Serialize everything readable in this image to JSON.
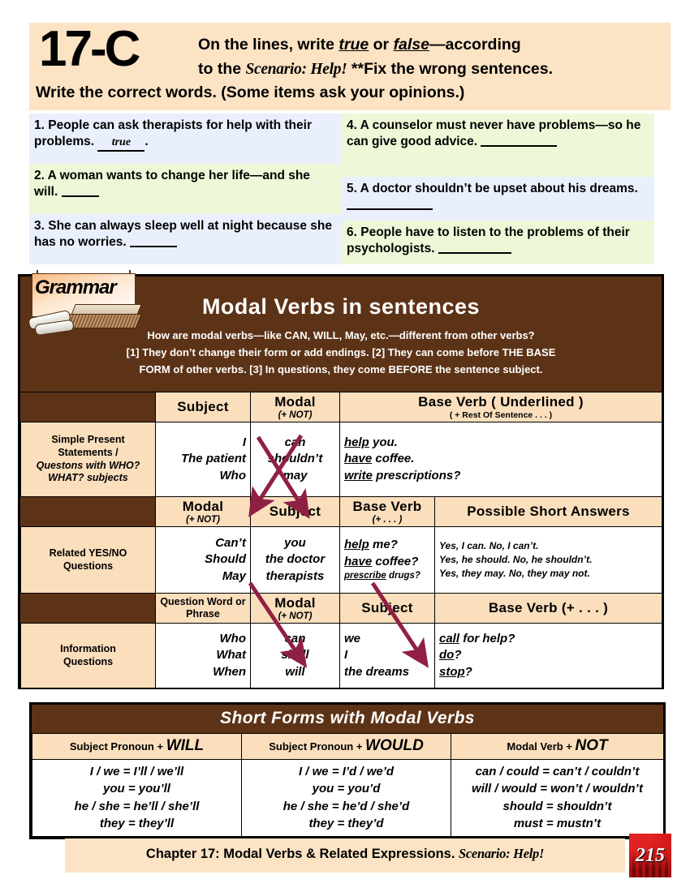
{
  "header": {
    "exercise_number": "17-C",
    "line1_pre": "On the lines, write ",
    "line1_true": "true",
    "line1_mid": " or ",
    "line1_false": "false",
    "line1_post": "—according",
    "line2_pre": "to the ",
    "line2_scenario": "Scenario: Help!",
    "line2_post": "  **Fix the wrong sentences.",
    "line3": "Write the correct words. (Some items ask your opinions.)"
  },
  "exercises": [
    {
      "num": "1.",
      "text": "People can ask therapists for help with their problems.",
      "answer": "true",
      "has_period": true,
      "blank_width": 0,
      "shade": "blue"
    },
    {
      "num": "2.",
      "text": "A woman wants to change her life—and she will.",
      "answer": "",
      "has_period": false,
      "blank_width": 46,
      "shade": "green"
    },
    {
      "num": "3.",
      "text": "She can always sleep well at night because she has no worries.",
      "answer": "",
      "has_period": false,
      "blank_width": 58,
      "shade": "blue"
    },
    {
      "num": "4.",
      "text": "A counselor must never have problems—so he can give good advice.",
      "answer": "",
      "has_period": false,
      "blank_width": 94,
      "shade": "green"
    },
    {
      "num": "5.",
      "text": "A doctor shouldn’t be upset about his dreams.",
      "answer": "",
      "has_period": false,
      "blank_width": 106,
      "shade": "blue"
    },
    {
      "num": "6.",
      "text": "People have to listen to the problems of their psychologists.",
      "answer": "",
      "has_period": false,
      "blank_width": 90,
      "shade": "green"
    }
  ],
  "grammar": {
    "logo_label": "Grammar",
    "title": "Modal Verbs in sentences",
    "intro_line1": "How are modal verbs—like CAN,  WILL, May, etc.—different from other verbs?",
    "intro_line2": "[1] They don’t change their form or add endings.  [2] They can come before THE BASE",
    "intro_line3": "FORM of other verbs.   [3]  In questions, they come BEFORE the sentence subject."
  },
  "table": {
    "header_row_1": {
      "subject": "Subject",
      "modal": "Modal",
      "modal_sub": "(+ NOT)",
      "base_verb": "Base Verb ( Underlined )",
      "base_verb_sub": "( + Rest Of Sentence . . . )"
    },
    "row_1": {
      "label_lines": [
        "Simple Present",
        "Statements /",
        "Questons with WHO?",
        "WHAT? subjects"
      ],
      "subjects": [
        "I",
        "The patient",
        "Who"
      ],
      "modals": [
        "can",
        "shouldn’t",
        "may"
      ],
      "base_verbs": [
        {
          "verb": "help",
          "rest": " you."
        },
        {
          "verb": "have",
          "rest": " coffee."
        },
        {
          "verb": "write",
          "rest": " prescriptions?"
        }
      ]
    },
    "header_row_2": {
      "modal": "Modal",
      "modal_sub": "(+ NOT)",
      "subject": "Subject",
      "base_verb": "Base Verb",
      "base_verb_sub": "(+ . . . )",
      "answers": "Possible Short Answers"
    },
    "row_2": {
      "label_lines": [
        "Related YES/NO",
        "Questions"
      ],
      "modals": [
        "Can’t",
        "Should",
        "May"
      ],
      "subjects": [
        "you",
        "the doctor",
        "therapists"
      ],
      "base_verbs": [
        {
          "verb": "help",
          "rest": " me?"
        },
        {
          "verb": "have",
          "rest": " coffee?"
        },
        {
          "verb": "prescribe",
          "rest": " drugs?"
        }
      ],
      "short_answers": [
        "Yes, I can. No, I can’t.",
        "Yes, he should. No, he shouldn’t.",
        "Yes, they may. No, they may not."
      ]
    },
    "header_row_3": {
      "qword": "Question Word or Phrase",
      "modal": "Modal",
      "modal_sub": "(+ NOT)",
      "subject": "Subject",
      "base_verb": "Base Verb  (+ . . . )"
    },
    "row_3": {
      "label_lines": [
        "Information",
        "Questions"
      ],
      "qwords": [
        "Who",
        "What",
        "When"
      ],
      "modals": [
        "can",
        "shall",
        "will"
      ],
      "subjects": [
        "we",
        "I",
        "the dreams"
      ],
      "base_verbs": [
        {
          "verb": "call",
          "rest": " for help?"
        },
        {
          "verb": "do",
          "rest": "?"
        },
        {
          "verb": "stop",
          "rest": "?"
        }
      ]
    }
  },
  "short_forms": {
    "title": "Short Forms with Modal Verbs",
    "columns": [
      {
        "head_small": "Subject Pronoun",
        "head_plus": " + ",
        "head_big": "WILL",
        "rows": [
          "I / we  = I’ll / we’ll",
          "you  = you’ll",
          "he / she  = he’ll / she’ll",
          "they  = they’ll"
        ]
      },
      {
        "head_small": "Subject Pronoun",
        "head_plus": " + ",
        "head_big": "WOULD",
        "rows": [
          "I / we  = I’d / we’d",
          "you  = you’d",
          "he / she  = he’d / she’d",
          "they  = they’d"
        ]
      },
      {
        "head_small": "Modal Verb",
        "head_plus": "  + ",
        "head_big": "NOT",
        "rows": [
          "can / could  = can’t / couldn’t",
          "will / would  = won’t / wouldn’t",
          "should  = shouldn’t",
          "must  = mustn’t"
        ]
      }
    ]
  },
  "footer": {
    "text_main": "Chapter 17: Modal Verbs & Related Expressions. ",
    "text_scenario": "Scenario: Help!",
    "page_number": "215"
  },
  "colors": {
    "banner_bg": "#fbe3c4",
    "brown": "#5d3317",
    "tan": "#fbdfbd",
    "row_blue": "#e9effc",
    "row_green": "#eef8d8",
    "arrow": "#8f2044",
    "page_badge_red": "#a80f0f"
  }
}
